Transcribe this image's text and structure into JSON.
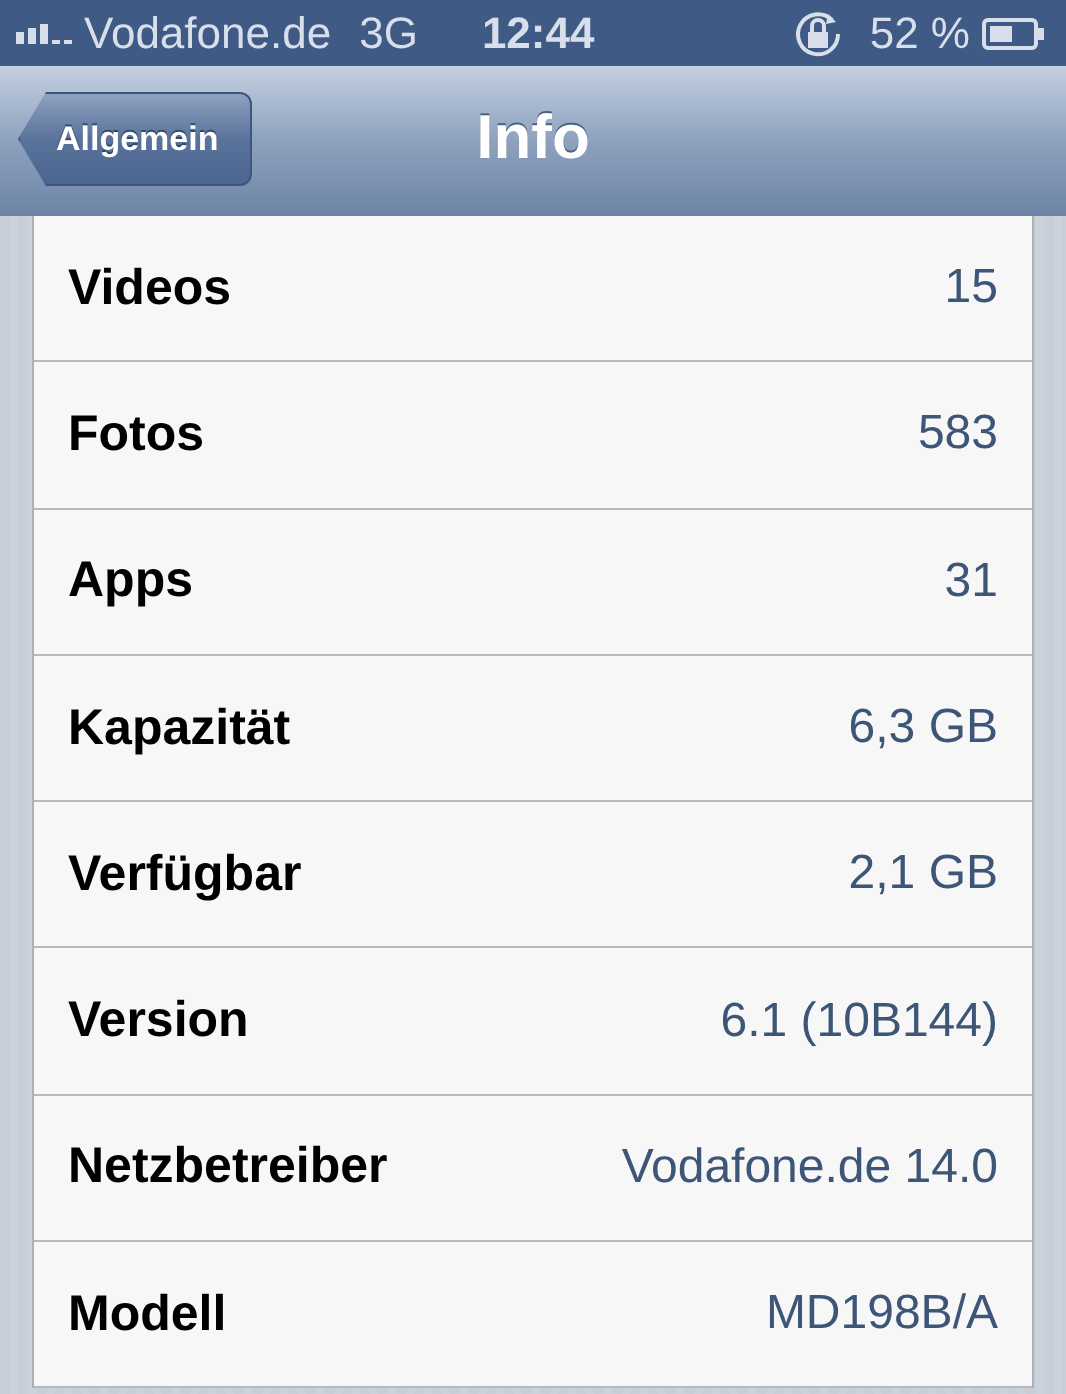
{
  "status_bar": {
    "carrier": "Vodafone.de",
    "network": "3G",
    "time": "12:44",
    "battery": "52 %"
  },
  "nav_bar": {
    "back_button": "Allgemein",
    "title": "Info"
  },
  "rows": [
    {
      "label": "Videos",
      "value": "15"
    },
    {
      "label": "Fotos",
      "value": "583"
    },
    {
      "label": "Apps",
      "value": "31"
    },
    {
      "label": "Kapazität",
      "value": "6,3 GB"
    },
    {
      "label": "Verfügbar",
      "value": "2,1 GB"
    },
    {
      "label": "Version",
      "value": "6.1 (10B144)"
    },
    {
      "label": "Netzbetreiber",
      "value": "Vodafone.de 14.0"
    },
    {
      "label": "Modell",
      "value": "MD198B/A"
    }
  ]
}
